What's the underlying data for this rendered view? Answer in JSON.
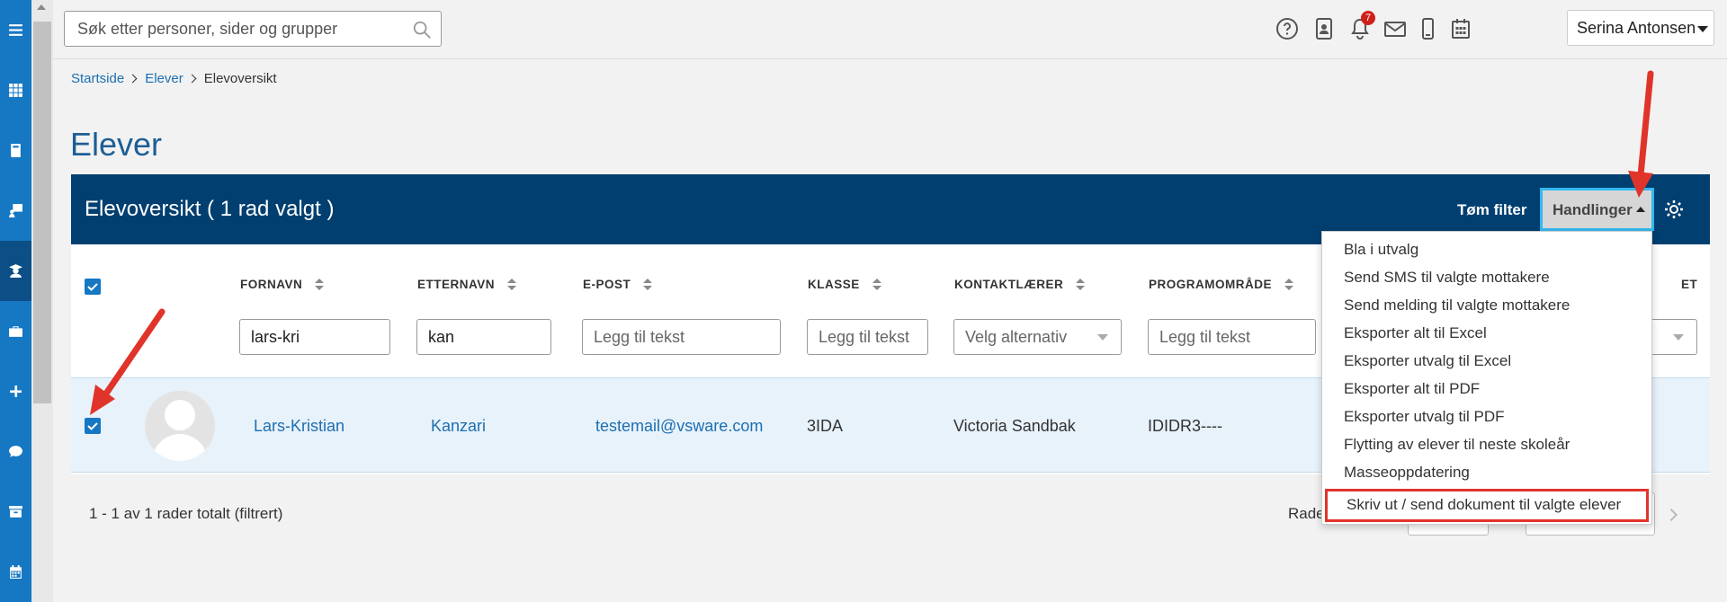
{
  "sidebar": {
    "items": [
      {
        "icon": "menu-icon"
      },
      {
        "icon": "apps-grid-icon"
      },
      {
        "icon": "book-icon"
      },
      {
        "icon": "teacher-board-icon"
      },
      {
        "icon": "student-icon",
        "active": true
      },
      {
        "icon": "briefcase-icon"
      },
      {
        "icon": "plus-icon"
      },
      {
        "icon": "chat-icon"
      },
      {
        "icon": "archive-icon"
      },
      {
        "icon": "calendar-icon"
      }
    ]
  },
  "topbar": {
    "search_placeholder": "Søk etter personer, sider og grupper",
    "notification_count": "7",
    "user_name": "Serina Antonsen"
  },
  "breadcrumb": {
    "items": [
      "Startside",
      "Elever"
    ],
    "current": "Elevoversikt"
  },
  "page": {
    "title": "Elever"
  },
  "panel": {
    "title": "Elevoversikt ( 1 rad valgt )",
    "clear_filter": "Tøm filter",
    "actions_label": "Handlinger"
  },
  "table": {
    "columns": [
      "FORNAVN",
      "ETTERNAVN",
      "E-POST",
      "KLASSE",
      "KONTAKTLÆRER",
      "PROGRAMOMRÅDE",
      "ET"
    ],
    "filters": {
      "fornavn": "lars-kri",
      "etternavn": "kan",
      "epost_placeholder": "Legg til tekst",
      "klasse_placeholder": "Legg til tekst",
      "kontaktlaerer_placeholder": "Velg alternativ",
      "programomrade_placeholder": "Legg til tekst"
    },
    "rows": [
      {
        "fornavn": "Lars-Kristian",
        "etternavn": "Kanzari",
        "epost": "testemail@vsware.com",
        "klasse": "3IDA",
        "kontaktlaerer": "Victoria Sandbak",
        "programomrade": "IDIDR3----",
        "selected": true
      }
    ]
  },
  "footer": {
    "info": "1 - 1 av 1 rader totalt (filtrert)",
    "rows_label": "Rade"
  },
  "actions_menu": {
    "items": [
      "Bla i utvalg",
      "Send SMS til valgte mottakere",
      "Send melding til valgte mottakere",
      "Eksporter alt til Excel",
      "Eksporter utvalg til Excel",
      "Eksporter alt til PDF",
      "Eksporter utvalg til PDF",
      "Flytting av elever til neste skoleår",
      "Masseoppdatering",
      "Skriv ut / send dokument til valgte elever"
    ],
    "highlighted_index": 9
  },
  "colors": {
    "sidebar": "#1677c2",
    "panel_header": "#003f70",
    "link": "#1d6fb0",
    "row_selected": "#e8f2fb",
    "annotation_arrow": "#e0342a"
  }
}
